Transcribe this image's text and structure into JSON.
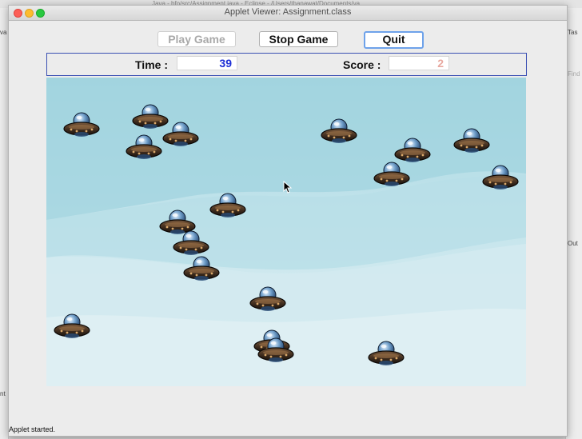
{
  "ide": {
    "top_path": "Java - bfo/src/Assignment.java - Eclipse - /Users/thanawat/Documents/ya",
    "left_fragments": [
      "va",
      "nt"
    ],
    "right_fragments": [
      "Tas",
      "Find",
      "Out"
    ]
  },
  "window": {
    "title": "Applet Viewer: Assignment.class"
  },
  "toolbar": {
    "play_label": "Play Game",
    "stop_label": "Stop Game",
    "quit_label": "Quit"
  },
  "stats": {
    "time_label": "Time :",
    "time_value": "39",
    "time_color": "#1d2fd6",
    "score_label": "Score :",
    "score_value": "2",
    "score_color": "#e8a9a0"
  },
  "game": {
    "ufo_count": 20,
    "sky_color": "#a8d8e2"
  },
  "status": {
    "text": "Applet started."
  }
}
